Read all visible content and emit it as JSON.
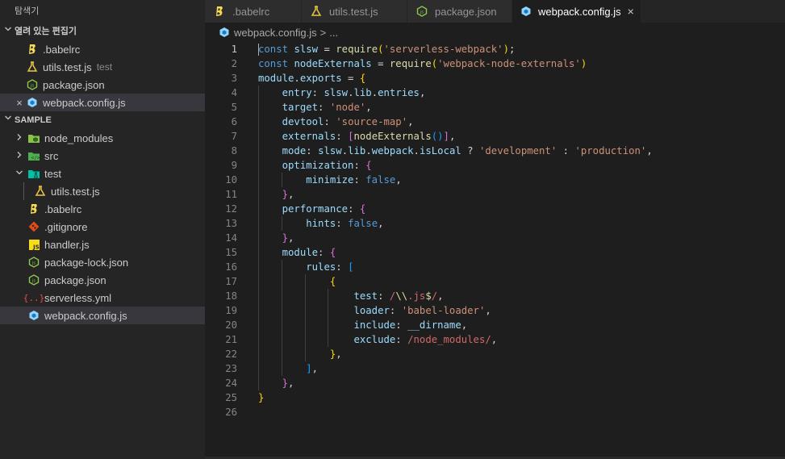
{
  "sidebar": {
    "title": "탐색기",
    "open_editors": {
      "header": "열려 있는 편집기",
      "items": [
        {
          "label": ".babelrc",
          "icon": "babel-icon",
          "description": ""
        },
        {
          "label": "utils.test.js",
          "icon": "test-flask-icon",
          "description": "test"
        },
        {
          "label": "package.json",
          "icon": "nodejs-icon",
          "description": ""
        },
        {
          "label": "webpack.config.js",
          "icon": "webpack-icon",
          "description": "",
          "active": true
        }
      ]
    },
    "project": {
      "header": "SAMPLE",
      "items": [
        {
          "label": "node_modules",
          "icon": "folder-node-icon",
          "type": "folder",
          "expanded": false
        },
        {
          "label": "src",
          "icon": "folder-src-icon",
          "type": "folder",
          "expanded": false
        },
        {
          "label": "test",
          "icon": "folder-test-icon",
          "type": "folder",
          "expanded": true
        },
        {
          "label": "utils.test.js",
          "icon": "test-flask-icon",
          "type": "file",
          "nested": true
        },
        {
          "label": ".babelrc",
          "icon": "babel-icon",
          "type": "file"
        },
        {
          "label": ".gitignore",
          "icon": "git-icon",
          "type": "file"
        },
        {
          "label": "handler.js",
          "icon": "js-icon",
          "type": "file"
        },
        {
          "label": "package-lock.json",
          "icon": "nodejs-icon",
          "type": "file"
        },
        {
          "label": "package.json",
          "icon": "nodejs-icon",
          "type": "file"
        },
        {
          "label": "serverless.yml",
          "icon": "yaml-icon",
          "type": "file"
        },
        {
          "label": "webpack.config.js",
          "icon": "webpack-icon",
          "type": "file",
          "selected": true
        }
      ]
    }
  },
  "tabs": [
    {
      "label": ".babelrc",
      "icon": "babel-icon",
      "active": false
    },
    {
      "label": "utils.test.js",
      "icon": "test-flask-icon",
      "active": false
    },
    {
      "label": "package.json",
      "icon": "nodejs-icon",
      "active": false
    },
    {
      "label": "webpack.config.js",
      "icon": "webpack-icon",
      "active": true
    }
  ],
  "breadcrumb": {
    "file": "webpack.config.js",
    "separator": ">",
    "ellipsis": "..."
  },
  "code": {
    "lines": [
      [
        [
          "const",
          "kw"
        ],
        [
          " ",
          ""
        ],
        [
          "slsw",
          "var"
        ],
        [
          " = ",
          "op"
        ],
        [
          "require",
          "fn"
        ],
        [
          "(",
          "b1"
        ],
        [
          "'serverless-webpack'",
          "str"
        ],
        [
          ")",
          "b1"
        ],
        [
          ";",
          "op"
        ]
      ],
      [
        [
          "const",
          "kw"
        ],
        [
          " ",
          ""
        ],
        [
          "nodeExternals",
          "var"
        ],
        [
          " = ",
          "op"
        ],
        [
          "require",
          "fn"
        ],
        [
          "(",
          "b1"
        ],
        [
          "'webpack-node-externals'",
          "str"
        ],
        [
          ")",
          "b1"
        ]
      ],
      [
        [
          "module",
          "var"
        ],
        [
          ".",
          "op"
        ],
        [
          "exports",
          "var"
        ],
        [
          " = ",
          "op"
        ],
        [
          "{",
          "b1"
        ]
      ],
      [
        [
          "    ",
          ""
        ],
        [
          "entry",
          "var"
        ],
        [
          ": ",
          "op"
        ],
        [
          "slsw",
          "var"
        ],
        [
          ".",
          "op"
        ],
        [
          "lib",
          "var"
        ],
        [
          ".",
          "op"
        ],
        [
          "entries",
          "var"
        ],
        [
          ",",
          "op"
        ]
      ],
      [
        [
          "    ",
          ""
        ],
        [
          "target",
          "var"
        ],
        [
          ": ",
          "op"
        ],
        [
          "'node'",
          "str"
        ],
        [
          ",",
          "op"
        ]
      ],
      [
        [
          "    ",
          ""
        ],
        [
          "devtool",
          "var"
        ],
        [
          ": ",
          "op"
        ],
        [
          "'source-map'",
          "str"
        ],
        [
          ",",
          "op"
        ]
      ],
      [
        [
          "    ",
          ""
        ],
        [
          "externals",
          "var"
        ],
        [
          ": ",
          "op"
        ],
        [
          "[",
          "b2"
        ],
        [
          "nodeExternals",
          "fn"
        ],
        [
          "(",
          "b3"
        ],
        [
          ")",
          "b3"
        ],
        [
          "]",
          "b2"
        ],
        [
          ",",
          "op"
        ]
      ],
      [
        [
          "    ",
          ""
        ],
        [
          "mode",
          "var"
        ],
        [
          ": ",
          "op"
        ],
        [
          "slsw",
          "var"
        ],
        [
          ".",
          "op"
        ],
        [
          "lib",
          "var"
        ],
        [
          ".",
          "op"
        ],
        [
          "webpack",
          "var"
        ],
        [
          ".",
          "op"
        ],
        [
          "isLocal",
          "var"
        ],
        [
          " ? ",
          "op"
        ],
        [
          "'development'",
          "str"
        ],
        [
          " : ",
          "op"
        ],
        [
          "'production'",
          "str"
        ],
        [
          ",",
          "op"
        ]
      ],
      [
        [
          "    ",
          ""
        ],
        [
          "optimization",
          "var"
        ],
        [
          ": ",
          "op"
        ],
        [
          "{",
          "b2"
        ]
      ],
      [
        [
          "        ",
          ""
        ],
        [
          "minimize",
          "var"
        ],
        [
          ": ",
          "op"
        ],
        [
          "false",
          "kw"
        ],
        [
          ",",
          "op"
        ]
      ],
      [
        [
          "    ",
          ""
        ],
        [
          "}",
          "b2"
        ],
        [
          ",",
          "op"
        ]
      ],
      [
        [
          "    ",
          ""
        ],
        [
          "performance",
          "var"
        ],
        [
          ": ",
          "op"
        ],
        [
          "{",
          "b2"
        ]
      ],
      [
        [
          "        ",
          ""
        ],
        [
          "hints",
          "var"
        ],
        [
          ": ",
          "op"
        ],
        [
          "false",
          "kw"
        ],
        [
          ",",
          "op"
        ]
      ],
      [
        [
          "    ",
          ""
        ],
        [
          "}",
          "b2"
        ],
        [
          ",",
          "op"
        ]
      ],
      [
        [
          "    ",
          ""
        ],
        [
          "module",
          "var"
        ],
        [
          ": ",
          "op"
        ],
        [
          "{",
          "b2"
        ]
      ],
      [
        [
          "        ",
          ""
        ],
        [
          "rules",
          "var"
        ],
        [
          ": ",
          "op"
        ],
        [
          "[",
          "b3"
        ]
      ],
      [
        [
          "            ",
          ""
        ],
        [
          "{",
          "b1"
        ]
      ],
      [
        [
          "                ",
          ""
        ],
        [
          "test",
          "var"
        ],
        [
          ": ",
          "op"
        ],
        [
          "/",
          "re"
        ],
        [
          "\\\\",
          "fn"
        ],
        [
          ".js",
          "re"
        ],
        [
          "$",
          "fn"
        ],
        [
          "/",
          "re"
        ],
        [
          ",",
          "op"
        ]
      ],
      [
        [
          "                ",
          ""
        ],
        [
          "loader",
          "var"
        ],
        [
          ": ",
          "op"
        ],
        [
          "'babel-loader'",
          "str"
        ],
        [
          ",",
          "op"
        ]
      ],
      [
        [
          "                ",
          ""
        ],
        [
          "include",
          "var"
        ],
        [
          ": ",
          "op"
        ],
        [
          "__dirname",
          "var"
        ],
        [
          ",",
          "op"
        ]
      ],
      [
        [
          "                ",
          ""
        ],
        [
          "exclude",
          "var"
        ],
        [
          ": ",
          "op"
        ],
        [
          "/node_modules/",
          "re"
        ],
        [
          ",",
          "op"
        ]
      ],
      [
        [
          "            ",
          ""
        ],
        [
          "}",
          "b1"
        ],
        [
          ",",
          "op"
        ]
      ],
      [
        [
          "        ",
          ""
        ],
        [
          "]",
          "b3"
        ],
        [
          ",",
          "op"
        ]
      ],
      [
        [
          "    ",
          ""
        ],
        [
          "}",
          "b2"
        ],
        [
          ",",
          "op"
        ]
      ],
      [
        [
          "}",
          "b1"
        ]
      ],
      []
    ],
    "current_line": 1
  },
  "colors": {
    "accent": "#007acc",
    "selection": "#37373d",
    "sidebar_bg": "#252526",
    "editor_bg": "#1e1e1e"
  }
}
